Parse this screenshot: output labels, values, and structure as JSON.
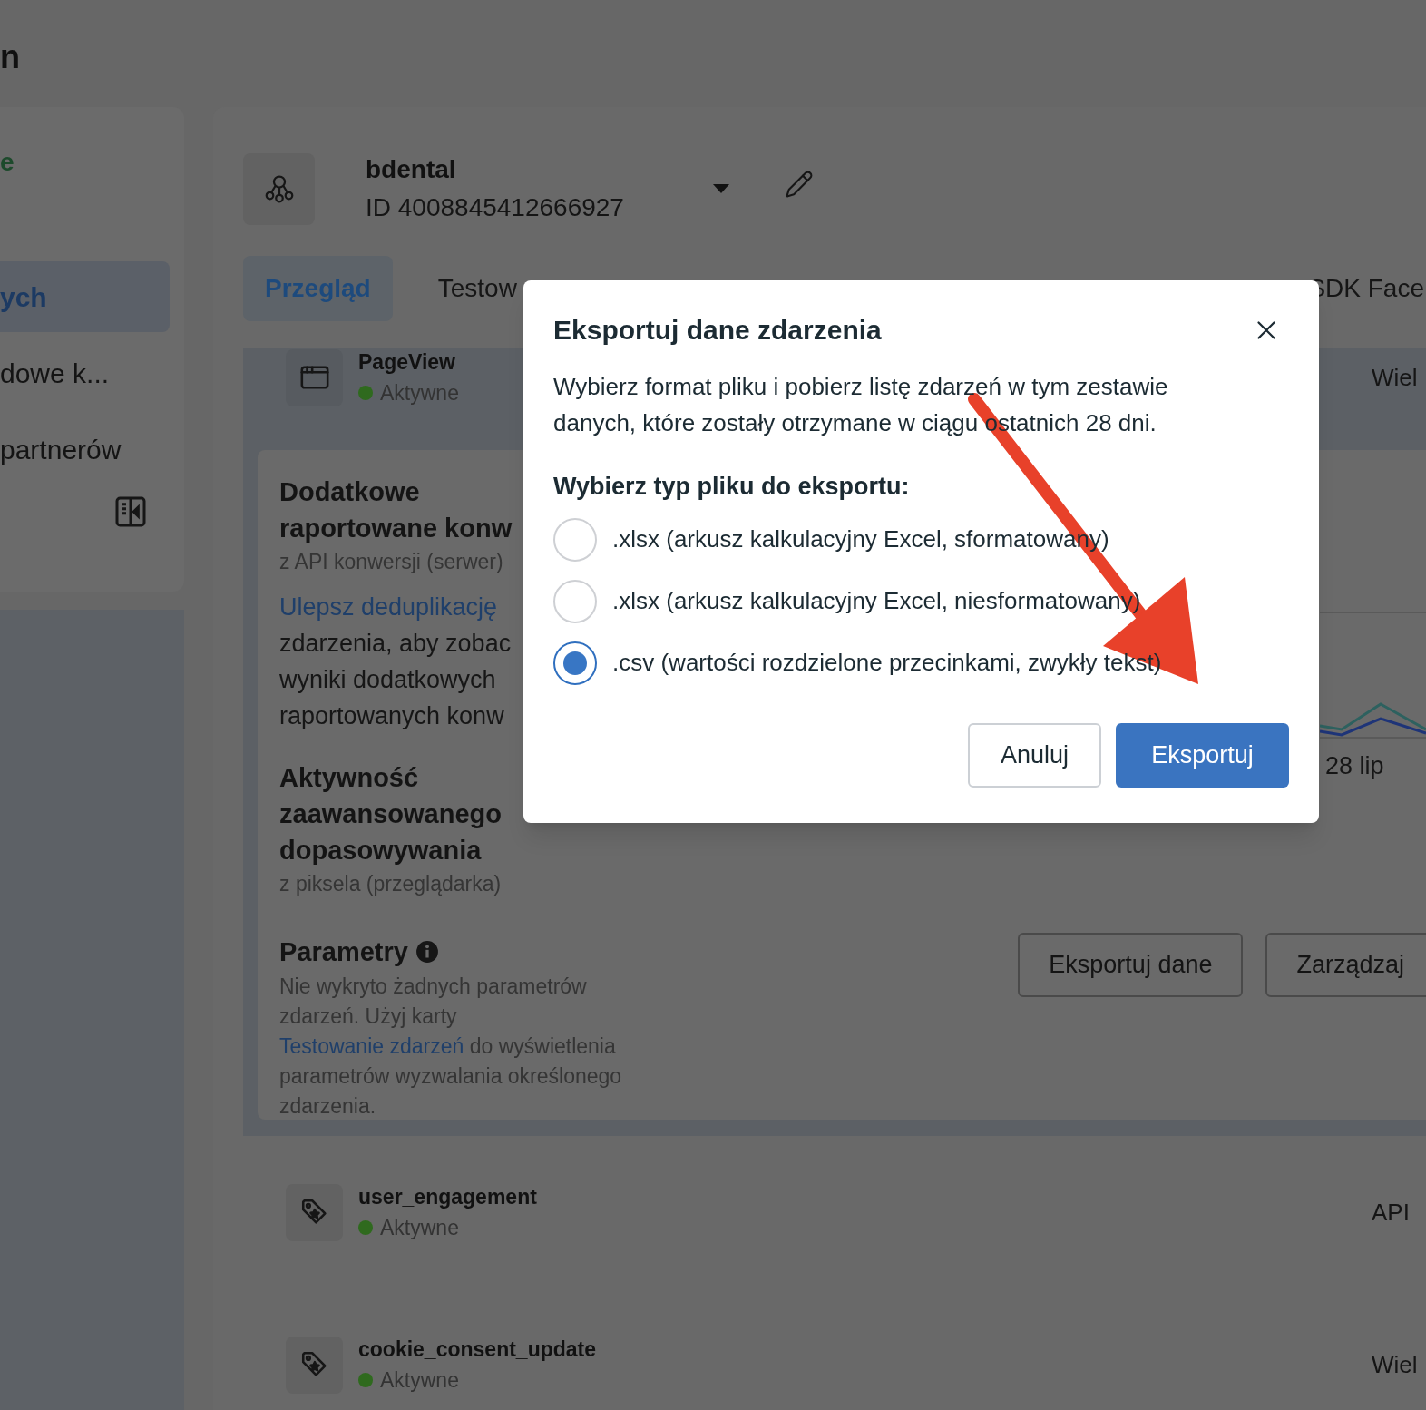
{
  "page_title": "n",
  "sidebar": {
    "heading": "e",
    "items": [
      {
        "label": "ych",
        "selected": true
      },
      {
        "label": "dowe k...",
        "selected": false
      },
      {
        "label": "partnerów",
        "selected": false
      }
    ]
  },
  "dataset": {
    "name": "bdental",
    "id": "ID 4008845412666927"
  },
  "tabs": [
    {
      "label": "Przegląd",
      "selected": true
    },
    {
      "label": "Testow",
      "selected": false
    },
    {
      "label": "SDK Face",
      "selected": false
    }
  ],
  "events": [
    {
      "name": "PageView",
      "status": "Aktywne",
      "source": "Wiel",
      "kind": "browser",
      "expanded": true
    },
    {
      "name": "user_engagement",
      "status": "Aktywne",
      "source": "API",
      "kind": "tag",
      "expanded": false
    },
    {
      "name": "cookie_consent_update",
      "status": "Aktywne",
      "source": "Wiel",
      "kind": "tag",
      "expanded": false
    }
  ],
  "details": {
    "sections": [
      {
        "title_lines": [
          "Dodatkowe",
          "raportowane konw"
        ],
        "subtitle": "z API konwersji (serwer)",
        "link": "Ulepsz deduplikację",
        "lines": [
          "zdarzenia, aby zobac",
          "wyniki dodatkowych",
          "raportowanych konw"
        ]
      },
      {
        "title_lines": [
          "Aktywność",
          "zaawansowanego",
          "dopasowywania"
        ],
        "subtitle": "z piksela (przeglądarka)"
      }
    ],
    "chart_label": "28 lip",
    "parameters": {
      "title": "Parametry",
      "text_before": "Nie wykryto żadnych parametrów zdarzeń. Użyj karty",
      "link": "Testowanie zdarzeń",
      "text_after": "do wyświetlenia parametrów wyzwalania określonego zdarzenia."
    },
    "buttons": [
      "Eksportuj dane",
      "Zarządzaj"
    ]
  },
  "dialog": {
    "title": "Eksportuj dane zdarzenia",
    "text": "Wybierz format pliku i pobierz listę zdarzeń w tym zestawie danych, które zostały otrzymane w ciągu ostatnich 28 dni.",
    "prompt": "Wybierz typ pliku do eksportu:",
    "options": [
      {
        "label": ".xlsx (arkusz kalkulacyjny Excel, sformatowany)",
        "selected": false
      },
      {
        "label": ".xlsx (arkusz kalkulacyjny Excel, niesformatowany)",
        "selected": false
      },
      {
        "label": ".csv (wartości rozdzielone przecinkami, zwykły tekst)",
        "selected": true
      }
    ],
    "cancel": "Anuluj",
    "confirm": "Eksportuj"
  }
}
